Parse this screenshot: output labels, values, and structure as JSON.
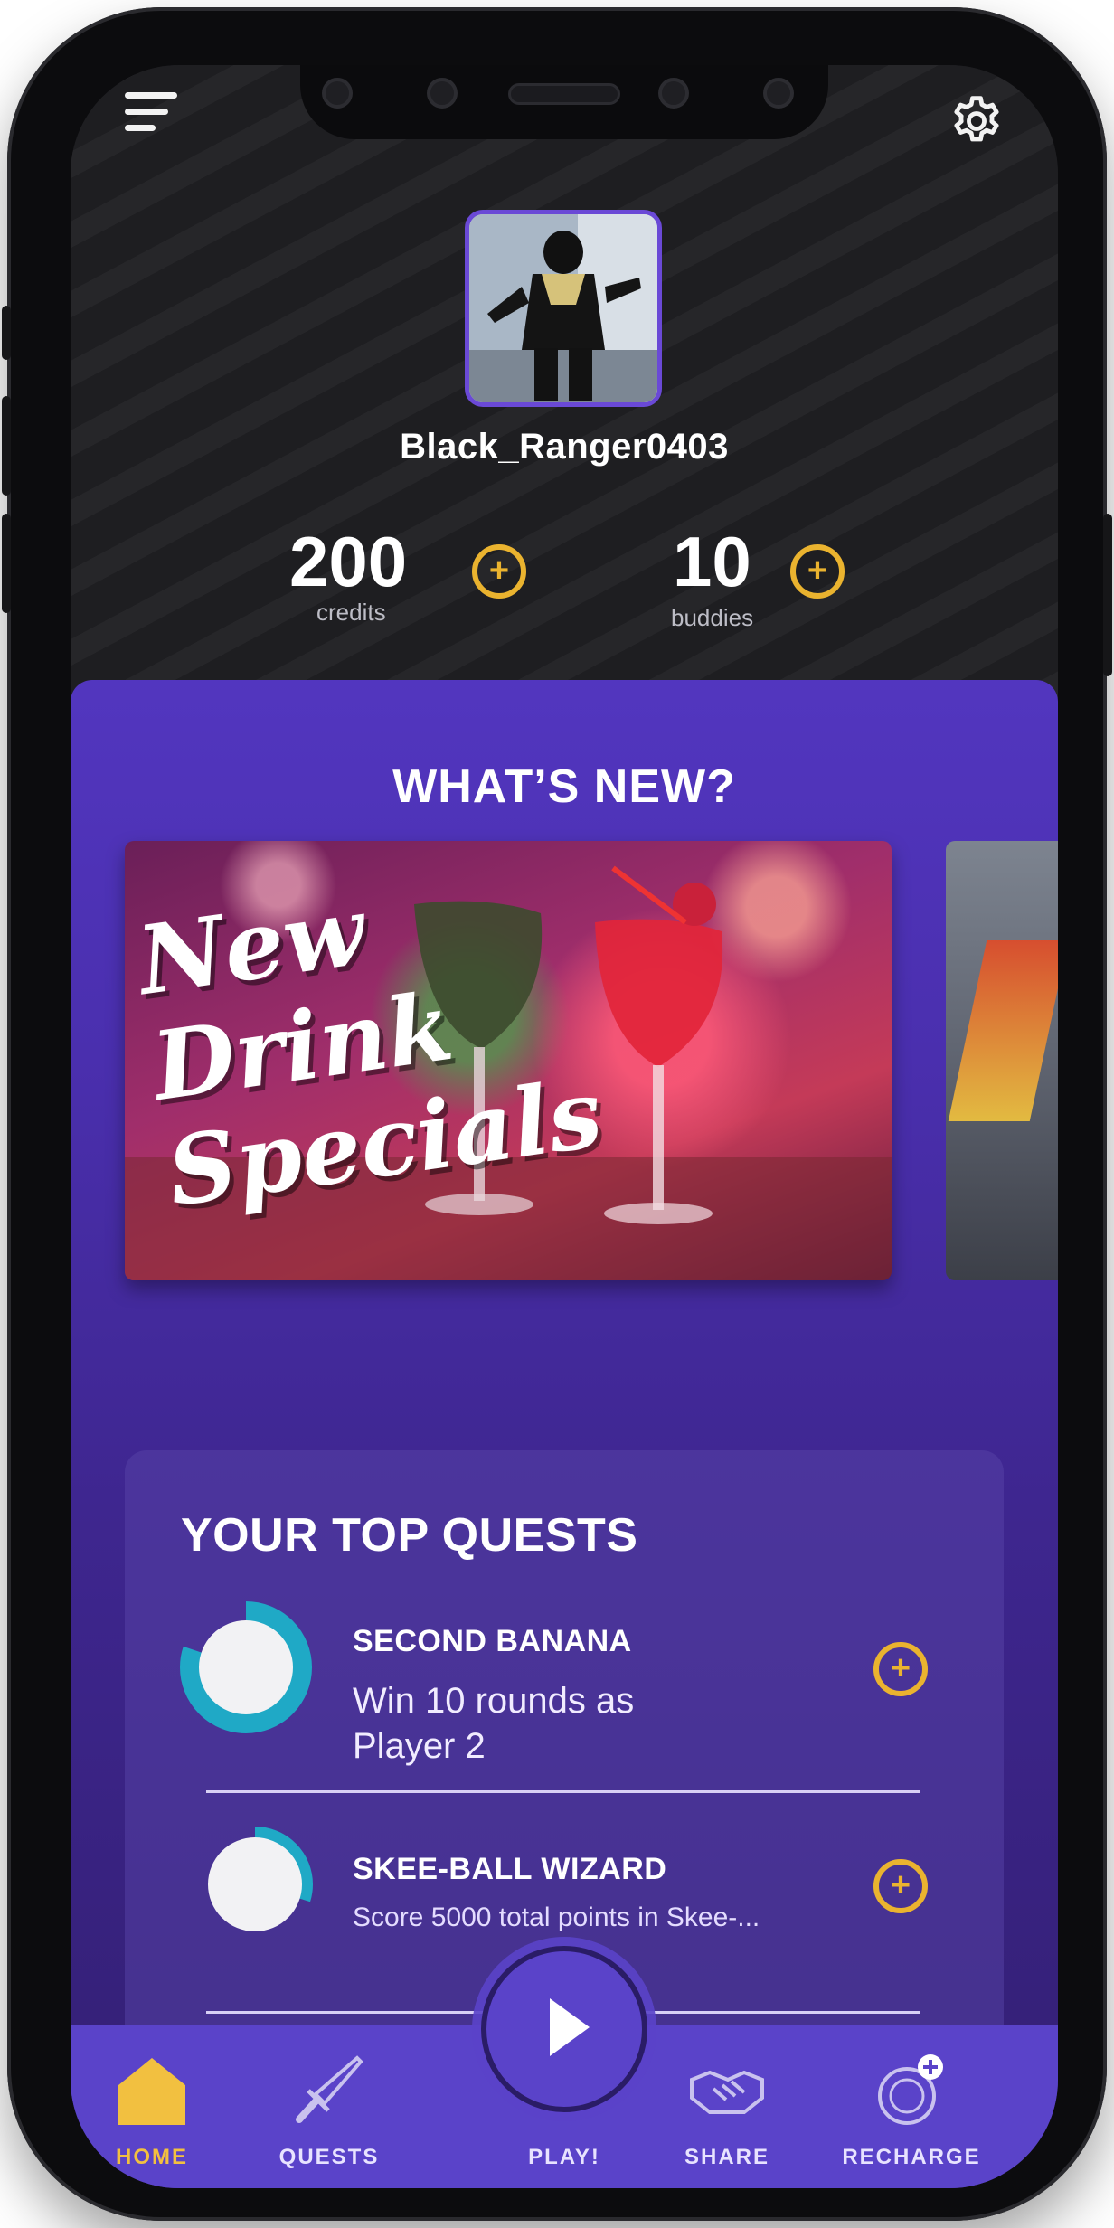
{
  "profile": {
    "username": "Black_Ranger0403",
    "credits_value": "200",
    "credits_label": "credits",
    "buddies_value": "10",
    "buddies_label": "buddies"
  },
  "whats_new": {
    "title": "WHAT’S NEW?",
    "banners": [
      {
        "text_line1": "New",
        "text_line2": "Drink",
        "text_line3": "Specials"
      }
    ]
  },
  "quests": {
    "title": "YOUR TOP QUESTS",
    "items": [
      {
        "name": "SECOND BANANA",
        "description": "Win 10 rounds as Player 2",
        "progress": 0.8
      },
      {
        "name": "SKEE-BALL WIZARD",
        "description": "Score 5000 total points in Skee-...",
        "progress": 0.3
      }
    ]
  },
  "nav": {
    "home": "HOME",
    "quests": "QUESTS",
    "play": "PLAY!",
    "share": "SHARE",
    "recharge": "RECHARGE"
  },
  "colors": {
    "accent_gold": "#eab32f",
    "purple": "#5236bf",
    "progress_teal": "#1fa9c6"
  }
}
